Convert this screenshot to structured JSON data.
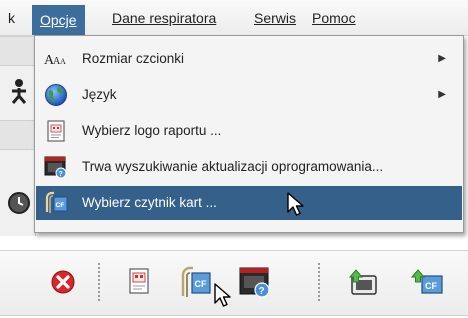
{
  "menubar": {
    "items": [
      {
        "label": "k"
      },
      {
        "label": "Opcje",
        "active": true
      },
      {
        "label": "Dane respiratora"
      },
      {
        "label": "Serwis"
      },
      {
        "label": "Pomoc"
      }
    ]
  },
  "menu": {
    "items": [
      {
        "label": "Rozmiar czcionki",
        "icon": "font-size-icon",
        "has_submenu": true
      },
      {
        "label": "Język",
        "icon": "globe-icon",
        "has_submenu": true
      },
      {
        "label": "Wybierz logo raportu ...",
        "icon": "report-logo-icon",
        "has_submenu": false
      },
      {
        "label": "Trwa wyszukiwanie aktualizacji oprogramowania...",
        "icon": "software-update-icon",
        "has_submenu": false
      },
      {
        "label": "Wybierz czytnik kart ...",
        "icon": "card-reader-icon",
        "has_submenu": false,
        "selected": true
      }
    ],
    "font_icon_text": "AAA",
    "submenu_arrow": "▶"
  },
  "toolbar": {
    "buttons": [
      {
        "icon": "close-red-icon"
      },
      {
        "icon": "report-logo-icon"
      },
      {
        "icon": "card-reader-icon"
      },
      {
        "icon": "software-update-icon"
      },
      {
        "icon": "upload-device-icon"
      },
      {
        "icon": "upload-cf-card-icon"
      }
    ]
  },
  "colors": {
    "menu_highlight": "#3b6e9c",
    "selected_row": "#35608a",
    "close_red": "#d9262c"
  }
}
